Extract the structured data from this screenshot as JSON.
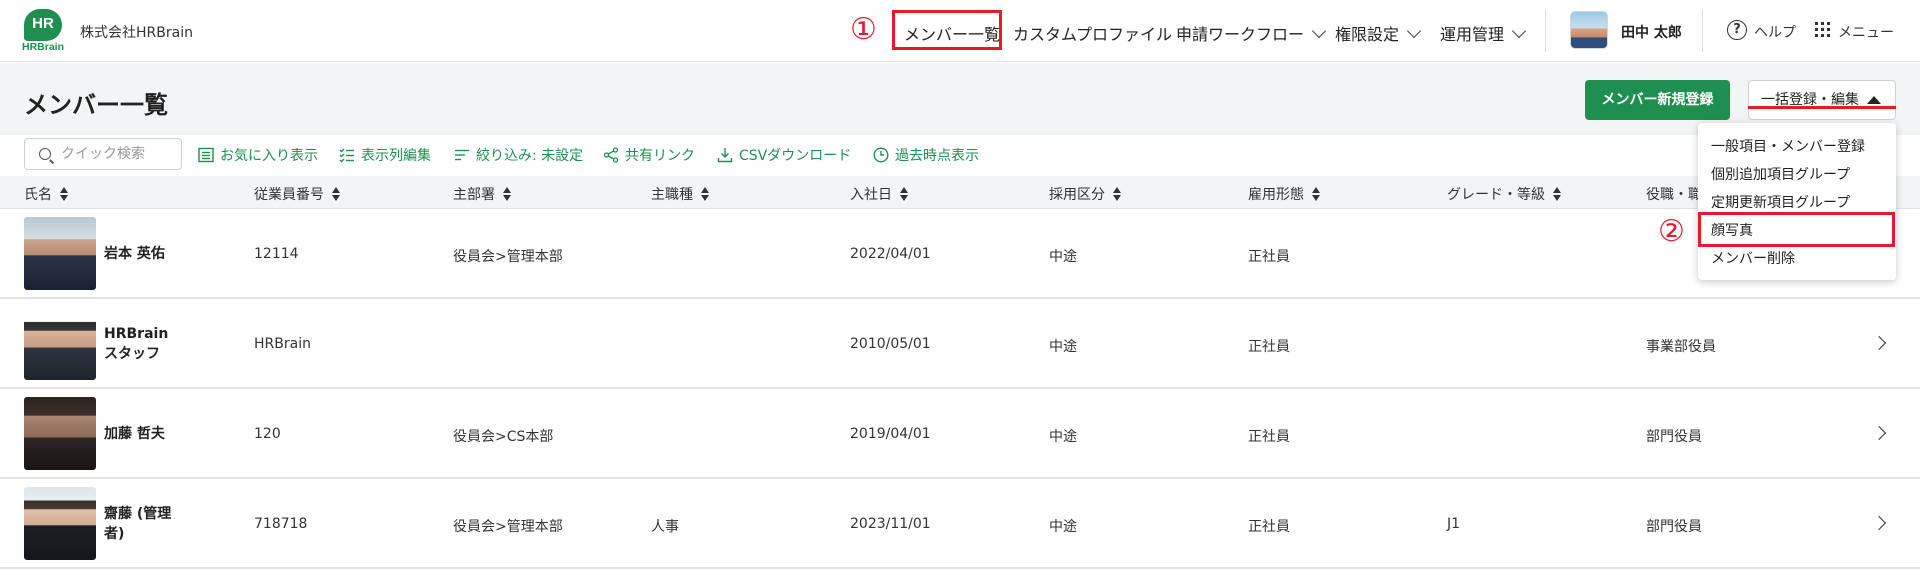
{
  "header": {
    "logo_mark": "HR",
    "logo_text": "HRBrain",
    "company": "株式会社HRBrain",
    "nav": [
      {
        "label": "メンバー一覧"
      },
      {
        "label": "カスタムプロファイル"
      },
      {
        "label": "申請ワークフロー"
      },
      {
        "label": "権限設定"
      },
      {
        "label": "運用管理"
      }
    ],
    "user_name": "田中 太郎",
    "help_label": "ヘルプ",
    "help_glyph": "?",
    "menu_label": "メニュー"
  },
  "annotations": {
    "marker1": "①",
    "marker2": "②",
    "color": "#e8192c"
  },
  "page": {
    "title": "メンバー一覧",
    "add_member_label": "メンバー新規登録",
    "bulk_label": "一括登録・編集"
  },
  "toolbar": {
    "search_placeholder": "クイック検索",
    "favorites": "お気に入り表示",
    "columns": "表示列編集",
    "filter": "絞り込み: 未設定",
    "share": "共有リンク",
    "csv": "CSVダウンロード",
    "past": "過去時点表示"
  },
  "table": {
    "headers": [
      "氏名",
      "従業員番号",
      "主部署",
      "主職種",
      "入社日",
      "採用区分",
      "雇用形態",
      "グレード・等級",
      "役職・職位"
    ],
    "rows": [
      {
        "name": "岩本 英佑",
        "emp_no": "12114",
        "dept": "役員会>管理本部",
        "job": "",
        "joined": "2022/04/01",
        "hire_type": "中途",
        "employment": "正社員",
        "grade": "",
        "position": ""
      },
      {
        "name": "HRBrain スタッフ",
        "emp_no": "HRBrain",
        "dept": "",
        "job": "",
        "joined": "2010/05/01",
        "hire_type": "中途",
        "employment": "正社員",
        "grade": "",
        "position": "事業部役員"
      },
      {
        "name": "加藤 哲夫",
        "emp_no": "120",
        "dept": "役員会>CS本部",
        "job": "",
        "joined": "2019/04/01",
        "hire_type": "中途",
        "employment": "正社員",
        "grade": "",
        "position": "部門役員"
      },
      {
        "name": "齋藤 (管理者)",
        "emp_no": "718718",
        "dept": "役員会>管理本部",
        "job": "人事",
        "joined": "2023/11/01",
        "hire_type": "中途",
        "employment": "正社員",
        "grade": "J1",
        "position": "部門役員"
      }
    ]
  },
  "dropdown": {
    "items": [
      "一般項目・メンバー登録",
      "個別追加項目グループ",
      "定期更新項目グループ",
      "顔写真",
      "メンバー削除"
    ]
  },
  "colors": {
    "brand": "#1f8f4f",
    "highlight": "#e8192c"
  }
}
